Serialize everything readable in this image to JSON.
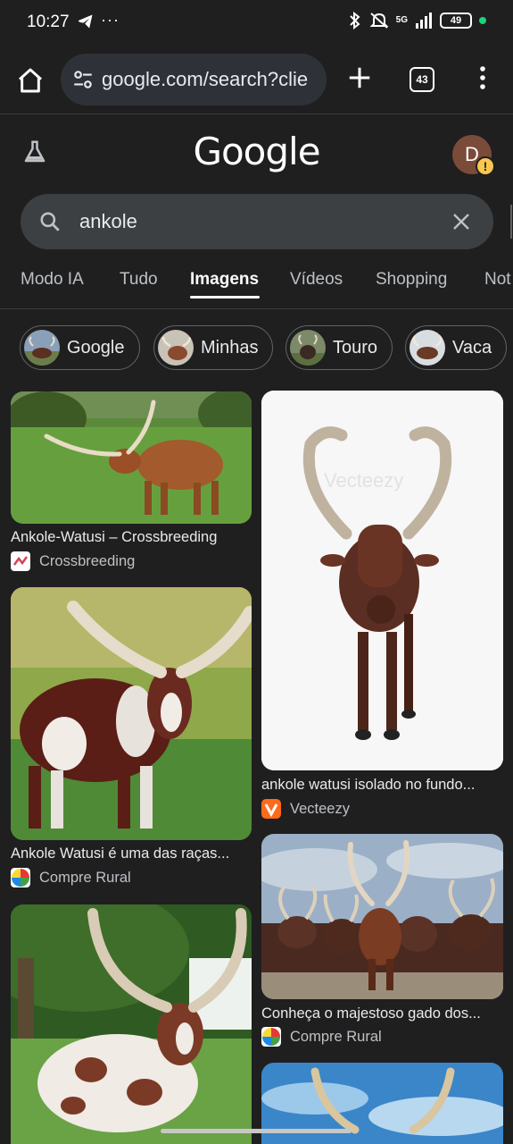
{
  "status_bar": {
    "time": "10:27",
    "dots": "···",
    "network": "5G",
    "battery": "49"
  },
  "browser": {
    "url": "google.com/search?clie",
    "tab_count": "43"
  },
  "header": {
    "logo": "Google",
    "avatar_letter": "D",
    "avatar_warning": "!"
  },
  "search": {
    "query": "ankole"
  },
  "tabs": [
    {
      "label": "Modo IA"
    },
    {
      "label": "Tudo"
    },
    {
      "label": "Imagens",
      "active": true
    },
    {
      "label": "Vídeos"
    },
    {
      "label": "Shopping"
    },
    {
      "label": "Not"
    }
  ],
  "chips": [
    {
      "label": "Google"
    },
    {
      "label": "Minhas"
    },
    {
      "label": "Touro"
    },
    {
      "label": "Vaca"
    }
  ],
  "results": [
    {
      "title": "Ankole-Watusi – Crossbreeding",
      "source": "Crossbreeding"
    },
    {
      "title": "ankole watusi isolado no fundo...",
      "source": "Vecteezy",
      "watermark": "Vecteezy"
    },
    {
      "title": "Ankole Watusi é uma das raças...",
      "source": "Compre Rural"
    },
    {
      "title": "Conheça o majestoso gado dos...",
      "source": "Compre Rural"
    },
    {
      "title": "",
      "source": ""
    },
    {
      "title": "",
      "source": ""
    }
  ],
  "colors": {
    "background": "#1f1f1f",
    "url_bar": "#2e3238",
    "search_box": "#3c4043",
    "vecteezy": "#ff6a1a",
    "avatar": "#7b4b3a",
    "warning": "#f9c74f"
  }
}
